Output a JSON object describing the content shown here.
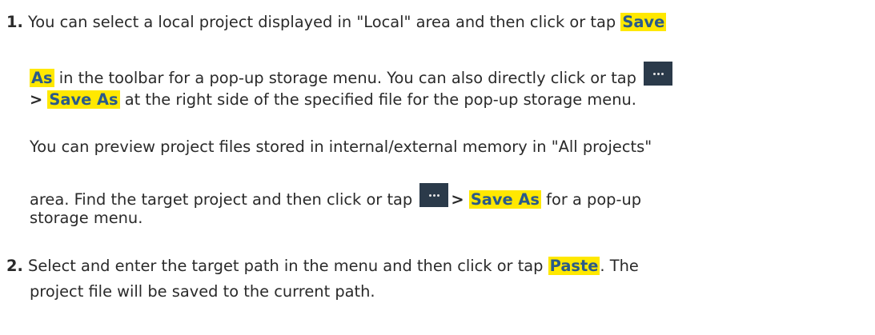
{
  "step1": {
    "number": "1.",
    "line1_text": "You can select a local project displayed in \"Local\" area and then click or tap ",
    "save_as_part1": "Save",
    "save_as_part2": "As",
    "line2_text": " in the toolbar for a pop-up storage menu. You can also directly click or tap ",
    "line3_arrow": ">",
    "save_as_full": "Save As",
    "line3_text": " at the right side of the specified file for the pop-up storage menu.",
    "para2_line1": "You can preview project files stored in internal/external memory in \"All projects\"",
    "para2_line2_text": "area. Find the target project and then click or tap ",
    "para2_arrow": ">",
    "para2_save_as": "Save As",
    "para2_line2_end": " for a pop-up",
    "para2_line3": "storage menu."
  },
  "step2": {
    "number": "2.",
    "line1_text": "Select and enter the target path in the menu and then click or tap ",
    "paste_label": "Paste",
    "line1_end": ". The",
    "line2": "project file will be saved to the current path."
  },
  "icons": {
    "more": "more-options-icon"
  },
  "colors": {
    "highlight": "#ffe800",
    "highlight_text": "#2a5a8a",
    "icon_bg": "#2b3a4a"
  }
}
